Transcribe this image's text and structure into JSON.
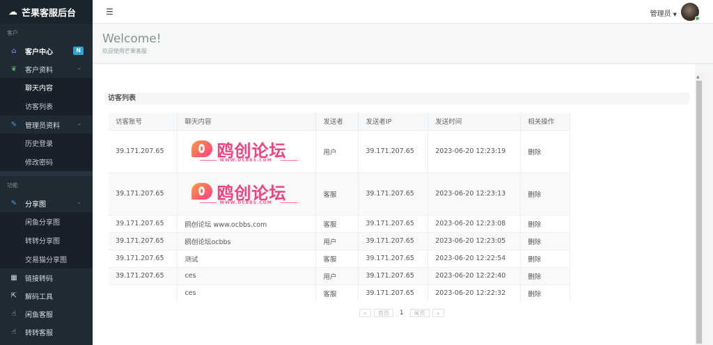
{
  "brand": {
    "title": "芒果客服后台",
    "icon": "cloud-icon"
  },
  "sidebar": {
    "section1": "客户",
    "section2": "功能",
    "customer_center": {
      "label": "客户中心",
      "badge": "N"
    },
    "customer_data": {
      "label": "客户资料"
    },
    "customer_sub": [
      "聊天内容",
      "访客列表"
    ],
    "admin_data": {
      "label": "管理员资料"
    },
    "admin_sub": [
      "历史登录",
      "修改密码"
    ],
    "share": {
      "label": "分享图"
    },
    "share_sub": [
      "闲鱼分享图",
      "转转分享图",
      "交易猫分享图"
    ],
    "tools": [
      "链接转码",
      "解码工具",
      "闲鱼客服",
      "转转客服"
    ]
  },
  "topbar": {
    "admin_label": "管理员"
  },
  "header": {
    "title": "Welcome!",
    "subtitle": "欢迎使用芒果客服"
  },
  "panel": {
    "title": "访客列表"
  },
  "table": {
    "headers": [
      "访客账号",
      "聊天内容",
      "发送者",
      "发送者IP",
      "发送时间",
      "相关操作"
    ],
    "rows": [
      {
        "account": "39.171.207.65",
        "content_type": "image",
        "sender": "用户",
        "ip": "39.171.207.65",
        "time": "2023-06-20 12:23:19",
        "action": "删除"
      },
      {
        "account": "39.171.207.65",
        "content_type": "image",
        "sender": "客服",
        "ip": "39.171.207.65",
        "time": "2023-06-20 12:23:13",
        "action": "删除"
      },
      {
        "account": "39.171.207.65",
        "content": "鸥创论坛 www.ocbbs.com",
        "sender": "客服",
        "ip": "39.171.207.65",
        "time": "2023-06-20 12:23:08",
        "action": "删除"
      },
      {
        "account": "39.171.207.65",
        "content": "鸥创论坛ocbbs",
        "sender": "用户",
        "ip": "39.171.207.65",
        "time": "2023-06-20 12:23:05",
        "action": "删除"
      },
      {
        "account": "39.171.207.65",
        "content": "测试",
        "sender": "客服",
        "ip": "39.171.207.65",
        "time": "2023-06-20 12:22:54",
        "action": "删除"
      },
      {
        "account": "39.171.207.65",
        "content": "ces",
        "sender": "用户",
        "ip": "39.171.207.65",
        "time": "2023-06-20 12:22:40",
        "action": "删除"
      },
      {
        "account": "",
        "content": "ces",
        "sender": "客服",
        "ip": "39.171.207.65",
        "time": "2023-06-20 12:22:32",
        "action": "删除"
      }
    ]
  },
  "chat_image": {
    "text": "鸥创论坛",
    "url": "WWW.OCBBS.COM"
  },
  "pager": {
    "first": "«",
    "prev": "首页",
    "current": "1",
    "next": "尾页",
    "last": "»"
  },
  "colors": {
    "sidebar_bg": "#1f2a34",
    "badge": "#23a6d5",
    "logo_pink": "#f0437f"
  }
}
